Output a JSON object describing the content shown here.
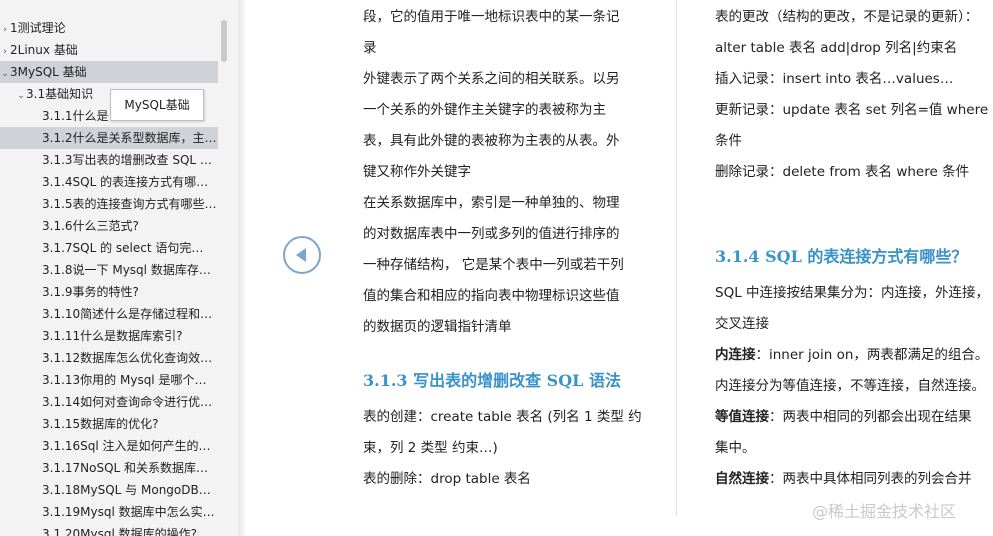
{
  "toc": {
    "items": [
      {
        "label": "1测试理论",
        "level": 0,
        "chevron": "›"
      },
      {
        "label": "2Linux 基础",
        "level": 0,
        "chevron": "›"
      },
      {
        "label": "3MySQL 基础",
        "level": 0,
        "chevron": "⌄",
        "selected": true
      },
      {
        "label": "3.1基础知识",
        "level": 1,
        "chevron": "⌄"
      },
      {
        "label": "3.1.1什么是",
        "level": 2
      },
      {
        "label": "3.1.2什么是关系型数据库，主…",
        "level": 2,
        "selected": true
      },
      {
        "label": "3.1.3写出表的增删改查 SQL …",
        "level": 2
      },
      {
        "label": "3.1.4SQL 的表连接方式有哪…",
        "level": 2
      },
      {
        "label": "3.1.5表的连接查询方式有哪些…",
        "level": 2
      },
      {
        "label": "3.1.6什么三范式?",
        "level": 2
      },
      {
        "label": "3.1.7SQL 的 select 语句完…",
        "level": 2
      },
      {
        "label": "3.1.8说一下 Mysql 数据库存…",
        "level": 2
      },
      {
        "label": "3.1.9事务的特性?",
        "level": 2
      },
      {
        "label": "3.1.10简述什么是存储过程和…",
        "level": 2
      },
      {
        "label": "3.1.11什么是数据库索引?",
        "level": 2
      },
      {
        "label": "3.1.12数据库怎么优化查询效…",
        "level": 2
      },
      {
        "label": "3.1.13你用的 Mysql 是哪个…",
        "level": 2
      },
      {
        "label": "3.1.14如何对查询命令进行优…",
        "level": 2
      },
      {
        "label": "3.1.15数据库的优化?",
        "level": 2
      },
      {
        "label": "3.1.16Sql 注入是如何产生的…",
        "level": 2
      },
      {
        "label": "3.1.17NoSQL 和关系数据库…",
        "level": 2
      },
      {
        "label": "3.1.18MySQL 与 MongoDB…",
        "level": 2
      },
      {
        "label": "3.1.19Mysql 数据库中怎么实…",
        "level": 2
      },
      {
        "label": "3.1.20Mysql 数据库的操作?",
        "level": 2
      }
    ],
    "tooltip": "MySQL基础"
  },
  "left_column": {
    "lines": [
      "段，它的值用于唯一地标识表中的某一条记",
      "录",
      "外键表示了两个关系之间的相关联系。以另",
      "一个关系的外键作主关键字的表被称为主",
      "表，具有此外键的表被称为主表的从表。外",
      "键又称作外关键字",
      "在关系数据库中，索引是一种单独的、物理",
      "的对数据库表中一列或多列的值进行排序的",
      "一种存储结构， 它是某个表中一列或若干列",
      "值的集合和相应的指向表中物理标识这些值",
      "的数据页的逻辑指针清单"
    ],
    "heading": "3.1.3  写出表的增删改查 SQL 语法",
    "lines2": [
      "表的创建：create table  表名  (列名 1  类型  约",
      "束，列 2  类型  约束…)",
      "表的删除：drop table  表名"
    ]
  },
  "right_column": {
    "lines": [
      "表的更改（结构的更改，不是记录的更新）：",
      "alter table  表名  add|drop  列名|约束名",
      "插入记录：insert into  表名…values…",
      "更新记录：update  表名  set  列名=值  where",
      "条件",
      "删除记录：delete from  表名  where  条件"
    ],
    "heading": "3.1.4  SQL 的表连接方式有哪些？",
    "lines2": [
      {
        "bold": "",
        "text": "SQL 中连接按结果集分为：内连接，外连接，"
      },
      {
        "bold": "",
        "text": "交叉连接"
      },
      {
        "bold": "内连接",
        "text": "：inner join on，两表都满足的组合。"
      },
      {
        "bold": "",
        "text": "内连接分为等值连接，不等连接，自然连接。"
      },
      {
        "bold": "等值连接",
        "text": "：两表中相同的列都会出现在结果"
      },
      {
        "bold": "",
        "text": "集中。"
      },
      {
        "bold": "自然连接",
        "text": "：两表中具体相同列表的列会合并"
      }
    ]
  },
  "watermark": "@稀土掘金技术社区",
  "colors": {
    "heading": "#3a93c8",
    "sidebar_bg": "#f3f3f3",
    "selected_bg": "#cfd2d6",
    "prev_button": "#7ea6cc"
  }
}
